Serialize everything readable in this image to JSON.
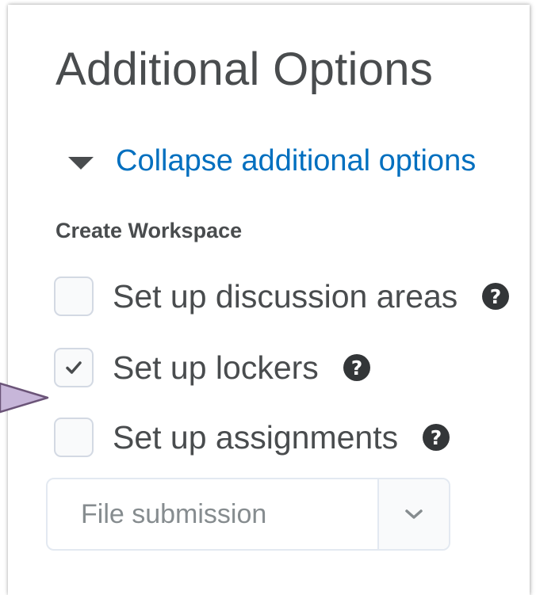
{
  "heading": "Additional Options",
  "collapse_link": {
    "label": "Collapse additional options",
    "icon": "caret-down-icon",
    "color": "#006fbf"
  },
  "section_title": "Create Workspace",
  "options": [
    {
      "label": "Set up discussion areas",
      "checked": false,
      "help_icon": "help-icon"
    },
    {
      "label": "Set up lockers",
      "checked": true,
      "help_icon": "help-icon"
    },
    {
      "label": "Set up assignments",
      "checked": false,
      "help_icon": "help-icon"
    }
  ],
  "submission_select": {
    "placeholder": "File submission",
    "icon": "chevron-down-icon"
  },
  "callout_arrow": {
    "color": "#c7b6d9",
    "border_color": "#6b5478"
  }
}
